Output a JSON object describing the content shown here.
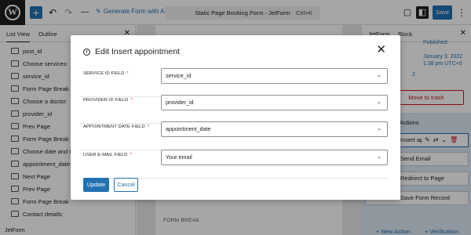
{
  "topbar": {
    "generate_label": "Generate Form with AI",
    "doc_title": "Static Page Booking Form - JetForm",
    "shortcut": "Ctrl+K",
    "save_label": "Save"
  },
  "left_panel": {
    "tabs": [
      "List View",
      "Outline"
    ],
    "items": [
      "post_id",
      "Choose services:",
      "service_id",
      "Form Page Break",
      "Choose a doctor:",
      "provider_id",
      "Prev Page",
      "Form Page Break",
      "Choose date and time:",
      "appointment_date",
      "Next Page",
      "Prev Page",
      "Form Page Break",
      "Contact details:"
    ],
    "bottom": "JetForm"
  },
  "canvas": {
    "form_break": "FORM BREAK"
  },
  "right_panel": {
    "tabs": [
      "JetForm",
      "Block"
    ],
    "status": "Published",
    "date_line1": "January 3, 2022",
    "date_line2": "1:38 pm UTC+0",
    "count": "2",
    "trash": "Move to trash",
    "actions_title": "Actions",
    "selected_action": "Insert appointment",
    "rows": [
      "Send Email",
      "Redirect to Page",
      "Save Form Record"
    ],
    "new_action": "+ New Action",
    "verification": "+ Verification"
  },
  "modal": {
    "title": "Edit Insert appointment",
    "fields": [
      {
        "label": "SERVICE ID FIELD",
        "value": "service_id"
      },
      {
        "label": "PROVIDER ID FIELD",
        "value": "provider_id"
      },
      {
        "label": "APPOINTMENT DATE FIELD",
        "value": "appointment_date"
      },
      {
        "label": "USER E-MAIL FIELD",
        "value": "Your email"
      }
    ],
    "required_mark": "*",
    "update_label": "Update",
    "cancel_label": "Cancel"
  },
  "colors": {
    "accent": "#2271b1",
    "danger": "#cc1818",
    "dark": "#1e1e1e"
  }
}
